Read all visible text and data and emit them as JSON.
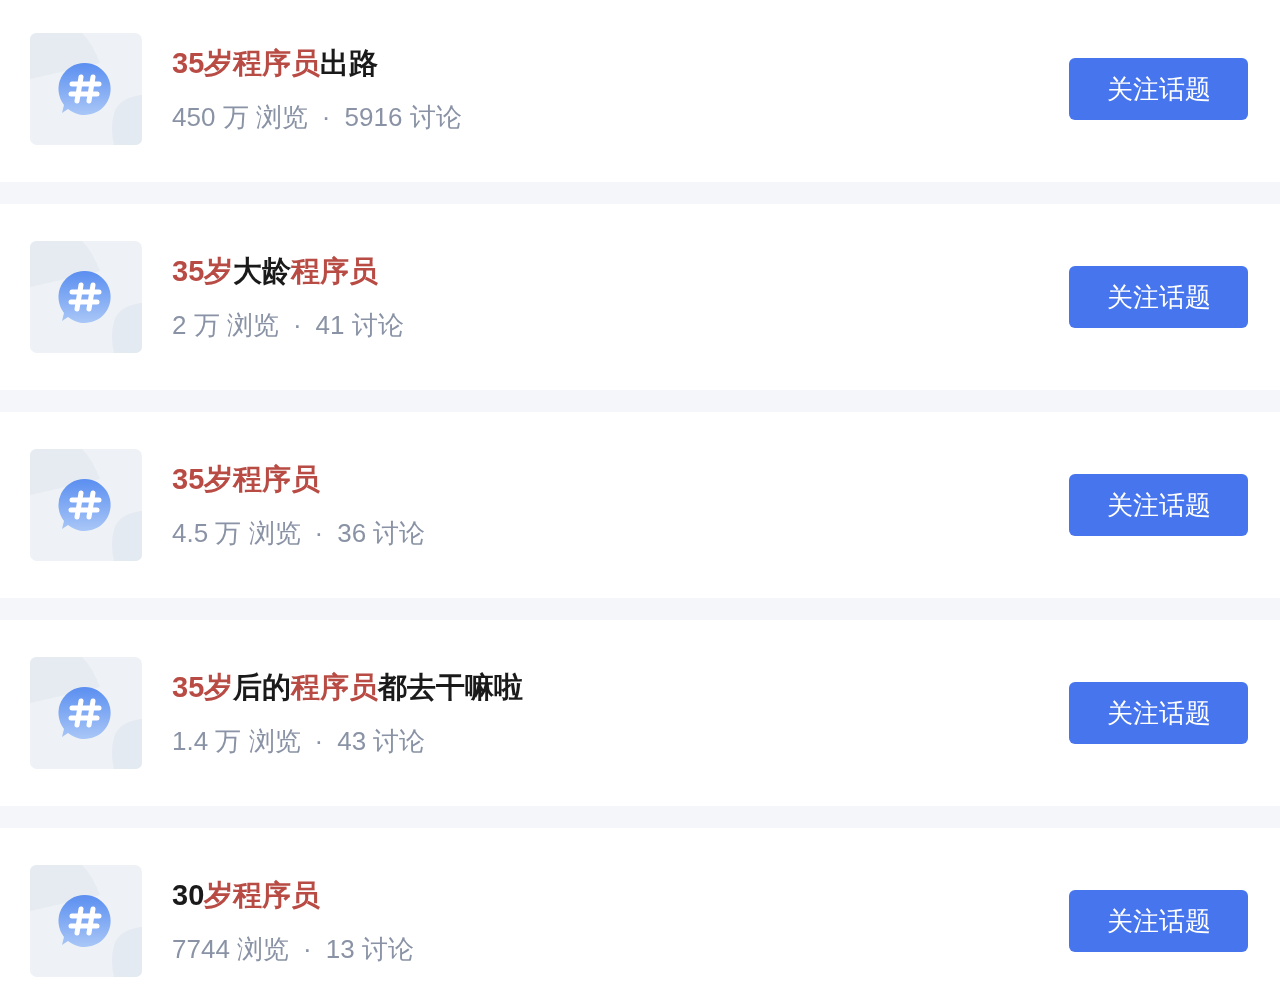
{
  "topics": [
    {
      "title_parts": [
        {
          "text": "35岁程序员",
          "highlighted": true
        },
        {
          "text": "出路",
          "highlighted": false
        }
      ],
      "views": "450 万 浏览",
      "separator": "·",
      "discussions": "5916 讨论",
      "follow_button": "关注话题"
    },
    {
      "title_parts": [
        {
          "text": "35岁",
          "highlighted": true
        },
        {
          "text": "大龄",
          "highlighted": false
        },
        {
          "text": "程序员",
          "highlighted": true
        }
      ],
      "views": "2 万 浏览",
      "separator": "·",
      "discussions": "41 讨论",
      "follow_button": "关注话题"
    },
    {
      "title_parts": [
        {
          "text": "35岁程序员",
          "highlighted": true
        }
      ],
      "views": "4.5 万 浏览",
      "separator": "·",
      "discussions": "36 讨论",
      "follow_button": "关注话题"
    },
    {
      "title_parts": [
        {
          "text": "35岁",
          "highlighted": true
        },
        {
          "text": "后的",
          "highlighted": false
        },
        {
          "text": "程序员",
          "highlighted": true
        },
        {
          "text": "都去干嘛啦",
          "highlighted": false
        }
      ],
      "views": "1.4 万 浏览",
      "separator": "·",
      "discussions": "43 讨论",
      "follow_button": "关注话题"
    },
    {
      "title_parts": [
        {
          "text": "30",
          "highlighted": false
        },
        {
          "text": "岁程序员",
          "highlighted": true
        }
      ],
      "views": "7744 浏览",
      "separator": "·",
      "discussions": "13 讨论",
      "follow_button": "关注话题"
    }
  ]
}
